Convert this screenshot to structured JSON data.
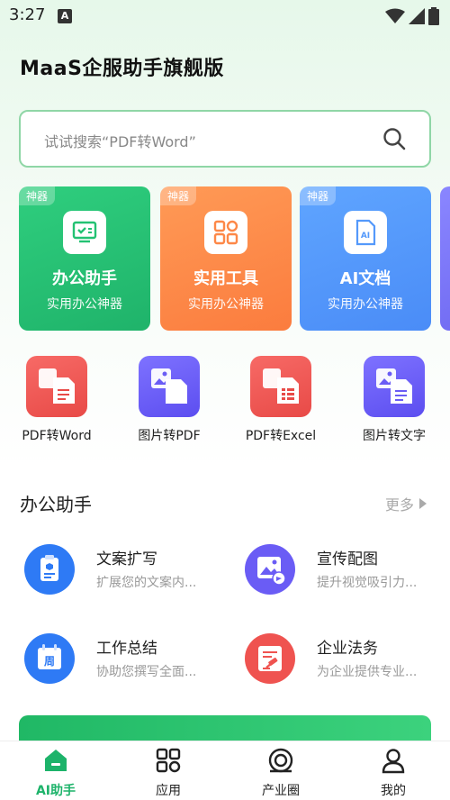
{
  "status": {
    "time": "3:27",
    "notification": "A"
  },
  "header": {
    "title": "MaaS企服助手旗舰版"
  },
  "search": {
    "placeholder": "试试搜索“PDF转Word”"
  },
  "feature_cards": [
    {
      "badge": "神器",
      "title": "办公助手",
      "subtitle": "实用办公神器",
      "icon": "office-assistant-icon",
      "color": "#23c273"
    },
    {
      "badge": "神器",
      "title": "实用工具",
      "subtitle": "实用办公神器",
      "icon": "grid-tools-icon",
      "color": "#fd8848"
    },
    {
      "badge": "神器",
      "title": "AI文档",
      "subtitle": "实用办公神器",
      "icon": "ai-document-icon",
      "color": "#5499fb"
    }
  ],
  "tools": [
    {
      "label": "PDF转Word",
      "icon": "pdf-to-word-icon",
      "color": "#ef5350"
    },
    {
      "label": "图片转PDF",
      "icon": "image-to-pdf-icon",
      "color": "#6a5cf5"
    },
    {
      "label": "PDF转Excel",
      "icon": "pdf-to-excel-icon",
      "color": "#ef5350"
    },
    {
      "label": "图片转文字",
      "icon": "image-to-text-icon",
      "color": "#6a5cf5"
    }
  ],
  "office_section": {
    "title": "办公助手",
    "more": "更多",
    "items": [
      {
        "title": "文案扩写",
        "desc": "扩展您的文案内...",
        "icon": "copy-expand-icon"
      },
      {
        "title": "宣传配图",
        "desc": "提升视觉吸引力...",
        "icon": "promo-image-icon"
      },
      {
        "title": "工作总结",
        "desc": "协助您撰写全面...",
        "icon": "calendar-week-icon",
        "icon_text": "周"
      },
      {
        "title": "企业法务",
        "desc": "为企业提供专业...",
        "icon": "legal-gavel-icon"
      }
    ]
  },
  "bottom_nav": [
    {
      "label": "AI助手",
      "icon": "home-icon",
      "active": true
    },
    {
      "label": "应用",
      "icon": "apps-grid-icon",
      "active": false
    },
    {
      "label": "产业圈",
      "icon": "target-circle-icon",
      "active": false
    },
    {
      "label": "我的",
      "icon": "user-icon",
      "active": false
    }
  ],
  "colors": {
    "accent": "#1db36a",
    "search_border": "#8fd6a6"
  }
}
